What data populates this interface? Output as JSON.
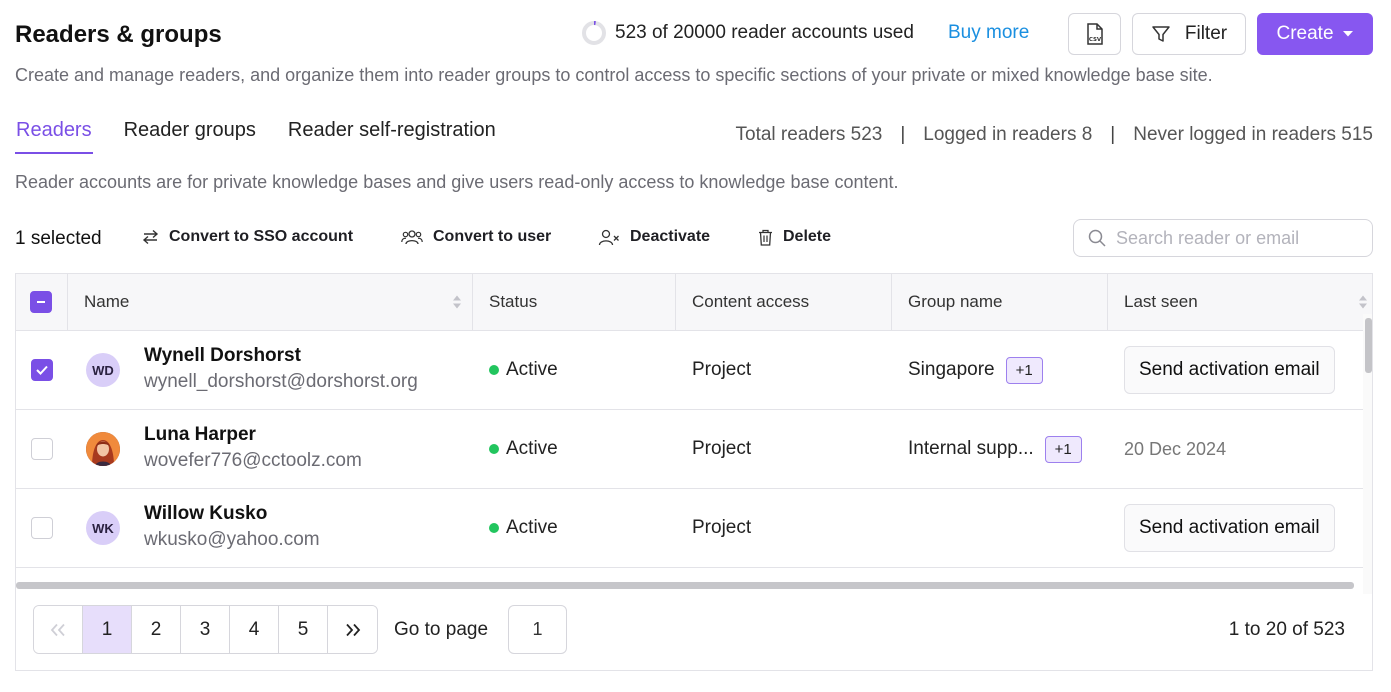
{
  "header": {
    "title": "Readers & groups",
    "quota_text": "523 of 20000 reader accounts used",
    "quota_used": 523,
    "quota_total": 20000,
    "buy_more": "Buy more",
    "csv_icon": "csv-export-icon",
    "filter_label": "Filter",
    "create_label": "Create"
  },
  "subtitle": "Create and manage readers, and organize them into reader groups to control access to specific sections of your private or mixed knowledge base site.",
  "tabs": [
    {
      "label": "Readers",
      "active": true
    },
    {
      "label": "Reader groups",
      "active": false
    },
    {
      "label": "Reader self-registration",
      "active": false
    }
  ],
  "stats": {
    "total": "Total readers 523",
    "logged_in": "Logged in readers 8",
    "never_logged_in": "Never logged in readers 515"
  },
  "note": "Reader accounts are for private knowledge bases and give users read-only access to knowledge base content.",
  "actions": {
    "selected": "1 selected",
    "convert_sso": "Convert to SSO account",
    "convert_user": "Convert to user",
    "deactivate": "Deactivate",
    "delete": "Delete",
    "search_placeholder": "Search reader or email"
  },
  "table": {
    "columns": [
      "Name",
      "Status",
      "Content access",
      "Group name",
      "Last seen"
    ],
    "rows": [
      {
        "checked": true,
        "initials": "WD",
        "name": "Wynell Dorshorst",
        "email": "wynell_dorshorst@dorshorst.org",
        "status": "Active",
        "content_access": "Project",
        "group": "Singapore",
        "group_more": "+1",
        "last_seen": "Send activation email"
      },
      {
        "checked": false,
        "initials": "",
        "name": "Luna Harper",
        "email": "wovefer776@cctoolz.com",
        "status": "Active",
        "content_access": "Project",
        "group": "Internal supp...",
        "group_more": "+1",
        "last_seen": "20 Dec 2024"
      },
      {
        "checked": false,
        "initials": "WK",
        "name": "Willow Kusko",
        "email": "wkusko@yahoo.com",
        "status": "Active",
        "content_access": "Project",
        "group": "",
        "group_more": "",
        "last_seen": "Send activation email"
      }
    ]
  },
  "pagination": {
    "pages": [
      "1",
      "2",
      "3",
      "4",
      "5"
    ],
    "current": "1",
    "goto_label": "Go to page",
    "goto_value": "1",
    "range": "1 to 20 of 523"
  },
  "colors": {
    "accent": "#7a4fe6",
    "create_button": "#8757f0",
    "link": "#1a8fe0",
    "active_status": "#22c55e"
  }
}
